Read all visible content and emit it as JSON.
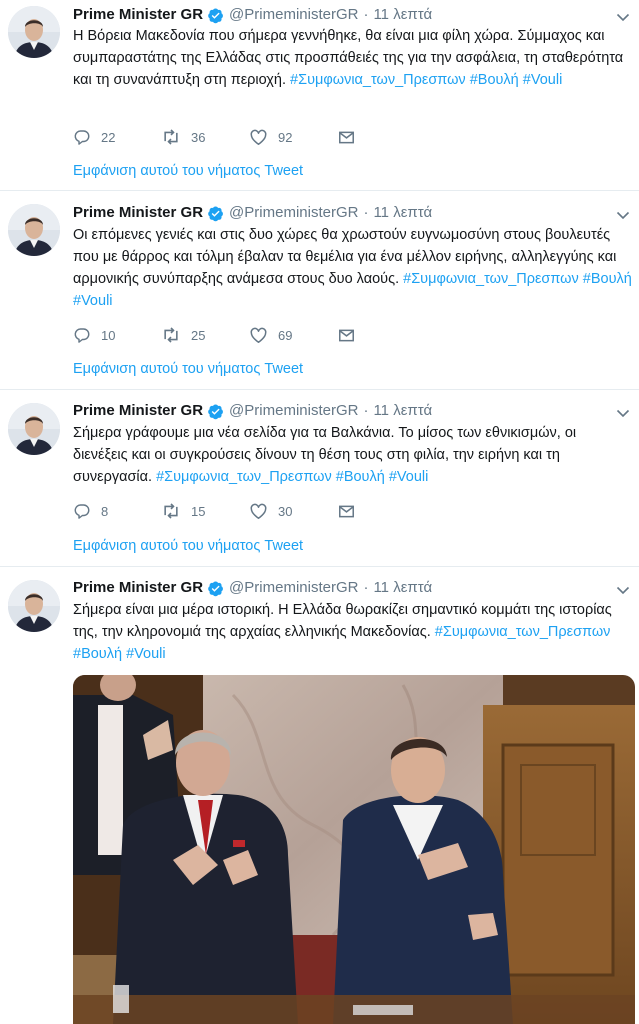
{
  "tweets": [
    {
      "name": "Prime Minister GR",
      "handle": "@PrimeministerGR",
      "separator": "·",
      "time": "11 λεπτά",
      "text": "Η Βόρεια Μακεδονία που σήμερα γεννήθηκε, θα είναι μια φίλη χώρα. Σύμμαχος και συμπαραστάτης της Ελλάδας στις προσπάθειές της για την ασφάλεια, τη σταθερότητα και τη συνανάπτυξη στη περιοχή.",
      "hashtags": [
        "#Συμφωνια_των_Πρεσπων",
        "#Βουλή",
        "#Vouli"
      ],
      "replies": "22",
      "retweets": "36",
      "likes": "92",
      "thread_link": "Εμφάνιση αυτού του νήματος Tweet"
    },
    {
      "name": "Prime Minister GR",
      "handle": "@PrimeministerGR",
      "separator": "·",
      "time": "11 λεπτά",
      "text": "Οι επόμενες γενιές και στις δυο χώρες θα χρωστούν ευγνωμοσύνη στους βουλευτές που με θάρρος και τόλμη έβαλαν τα θεμέλια για ένα μέλλον ειρήνης, αλληλεγγύης και αρμονικής συνύπαρξης ανάμεσα στους δυο λαούς.",
      "hashtags": [
        "#Συμφωνια_των_Πρεσπων",
        "#Βουλή",
        "#Vouli"
      ],
      "replies": "10",
      "retweets": "25",
      "likes": "69",
      "thread_link": "Εμφάνιση αυτού του νήματος Tweet"
    },
    {
      "name": "Prime Minister GR",
      "handle": "@PrimeministerGR",
      "separator": "·",
      "time": "11 λεπτά",
      "text": "Σήμερα γράφουμε μια νέα σελίδα για τα Βαλκάνια. Το μίσος των εθνικισμών, οι διενέξεις και οι συγκρούσεις δίνουν τη θέση τους στη φιλία, την ειρήνη και τη συνεργασία.",
      "hashtags": [
        "#Συμφωνια_των_Πρεσπων",
        "#Βουλή",
        "#Vouli"
      ],
      "replies": "8",
      "retweets": "15",
      "likes": "30",
      "thread_link": "Εμφάνιση αυτού του νήματος Tweet"
    },
    {
      "name": "Prime Minister GR",
      "handle": "@PrimeministerGR",
      "separator": "·",
      "time": "11 λεπτά",
      "text": "Σήμερα είναι μια μέρα ιστορική. Η Ελλάδα θωρακίζει σημαντικό κομμάτι της ιστορίας της, την κληρονομιά της αρχαίας ελληνικής Μακεδονίας.",
      "hashtags": [
        "#Συμφωνια_των_Πρεσπων",
        "#Βουλή",
        "#Vouli"
      ]
    }
  ],
  "colors": {
    "link": "#1da1f2",
    "secondary": "#657786",
    "divider": "#e6ecf0",
    "verified": "#1da1f2"
  },
  "icons": {
    "reply": "reply-icon",
    "retweet": "retweet-icon",
    "like": "heart-icon",
    "message": "direct-message-icon",
    "verified": "verified-badge-icon",
    "menu": "chevron-down-icon"
  }
}
